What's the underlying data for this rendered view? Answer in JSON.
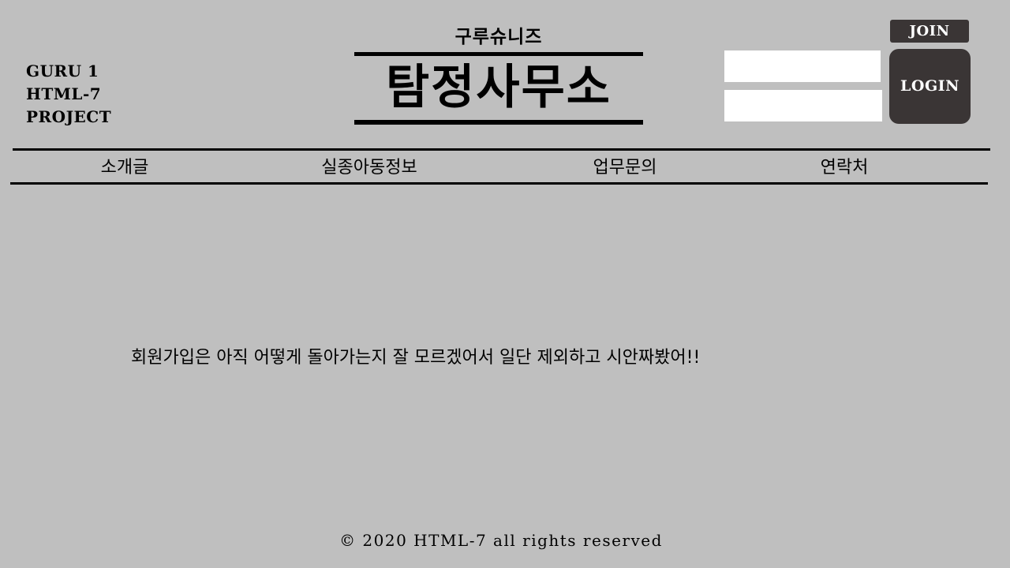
{
  "project": {
    "line1": "GURU 1",
    "line2": "HTML-7",
    "line3": "PROJECT"
  },
  "logo": {
    "subtitle": "구루슈니즈",
    "title": "탐정사무소"
  },
  "auth": {
    "id_value": "",
    "password_value": "",
    "join_label": "JOIN",
    "login_label": "LOGIN"
  },
  "nav": {
    "items": [
      {
        "label": "소개글"
      },
      {
        "label": "실종아동정보"
      },
      {
        "label": "업무문의"
      },
      {
        "label": "연락처"
      }
    ]
  },
  "main": {
    "notice": "회원가입은 아직 어떻게 돌아가는지 잘 모르겠어서 일단 제외하고 시안짜봤어!!"
  },
  "footer": {
    "text": "© 2020 HTML-7 all rights reserved"
  },
  "colors": {
    "background": "#bfbfbf",
    "button": "#3a3535",
    "input": "#ffffff"
  }
}
